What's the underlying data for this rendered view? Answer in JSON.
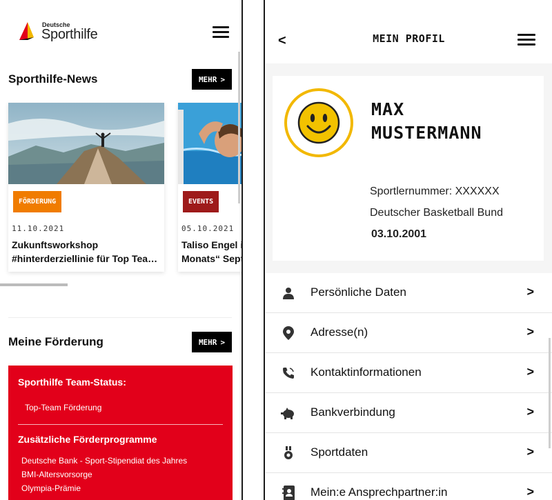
{
  "left": {
    "logo": {
      "small": "Deutsche",
      "big": "Sporthilfe"
    },
    "news_title": "Sporthilfe-News",
    "mehr_label": "MEHR",
    "news": [
      {
        "tag": "FÖRDERUNG",
        "tag_color": "#f07c00",
        "date": "11.10.2021",
        "title_line1": "Zukunftsworkshop",
        "title_line2": "#hinterderziellinie für Top Tea…"
      },
      {
        "tag": "EVENTS",
        "tag_color": "#9e1a1a",
        "date": "05.10.2021",
        "title_line1": "Taliso Engel is",
        "title_line2": "Monats“ Sept"
      }
    ],
    "foerderung_title": "Meine Förderung",
    "box": {
      "heading1": "Sporthilfe Team-Status:",
      "status": "Top-Team Förderung",
      "heading2": "Zusätzliche Förderprogramme",
      "programs": [
        "Deutsche Bank - Sport-Stipendiat des Jahres",
        "BMI-Altersvorsorge",
        "Olympia-Prämie"
      ]
    }
  },
  "right": {
    "title": "MEIN PROFIL",
    "name_line1": "MAX",
    "name_line2": "MUSTERMANN",
    "athlete_number": "Sportlernummer: XXXXXX",
    "federation": "Deutscher Basketball Bund",
    "birthdate": "03.10.2001",
    "menu": [
      {
        "label": "Persönliche Daten",
        "icon": "person-icon"
      },
      {
        "label": "Adresse(n)",
        "icon": "location-pin-icon"
      },
      {
        "label": "Kontaktinformationen",
        "icon": "phone-icon"
      },
      {
        "label": "Bankverbindung",
        "icon": "piggy-bank-icon"
      },
      {
        "label": "Sportdaten",
        "icon": "medal-icon"
      },
      {
        "label": "Mein:e Ansprechpartner:in",
        "icon": "contact-book-icon"
      }
    ]
  },
  "colors": {
    "accent_red": "#e2001a",
    "smiley_yellow": "#f2b800",
    "tag_orange": "#f07c00",
    "tag_darkred": "#9e1a1a"
  }
}
